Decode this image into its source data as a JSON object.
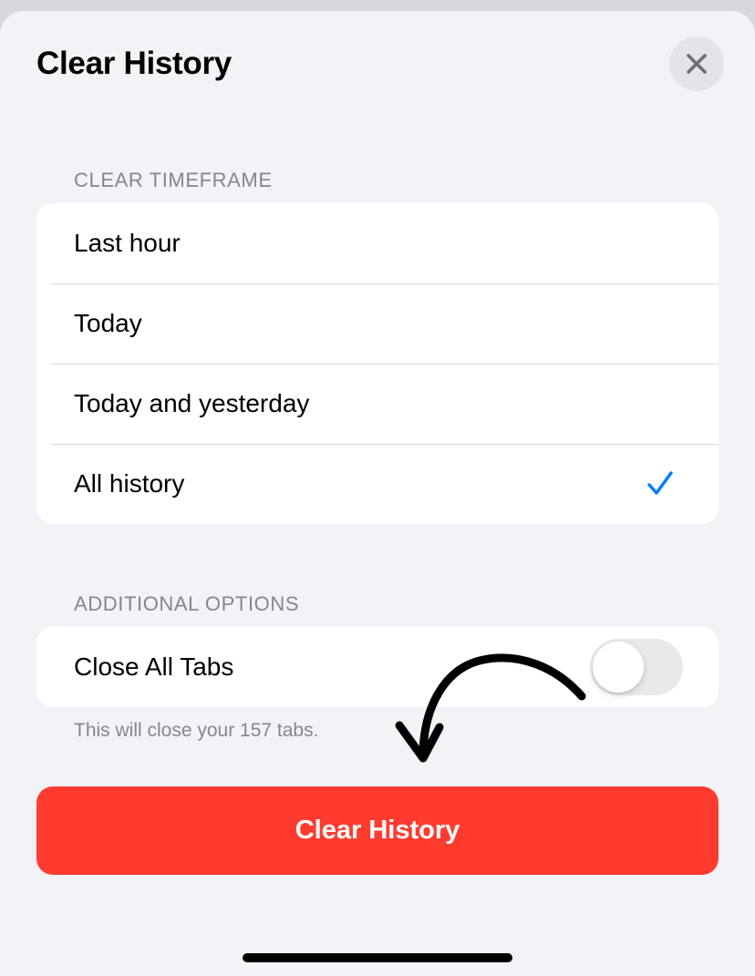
{
  "header": {
    "title": "Clear History"
  },
  "timeframe": {
    "header": "CLEAR TIMEFRAME",
    "options": [
      {
        "label": "Last hour",
        "selected": false
      },
      {
        "label": "Today",
        "selected": false
      },
      {
        "label": "Today and yesterday",
        "selected": false
      },
      {
        "label": "All history",
        "selected": true
      }
    ]
  },
  "additional": {
    "header": "ADDITIONAL OPTIONS",
    "close_all_tabs": {
      "label": "Close All Tabs",
      "enabled": false
    },
    "footnote": "This will close your 157 tabs."
  },
  "action": {
    "clear_label": "Clear History"
  },
  "icons": {
    "close": "close-icon",
    "check": "checkmark-icon",
    "annotation": "hand-drawn-arrow-icon"
  },
  "colors": {
    "accent": "#007aff",
    "destructive": "#ff3b30",
    "background": "#f2f2f7",
    "secondary_text": "#86868b"
  }
}
